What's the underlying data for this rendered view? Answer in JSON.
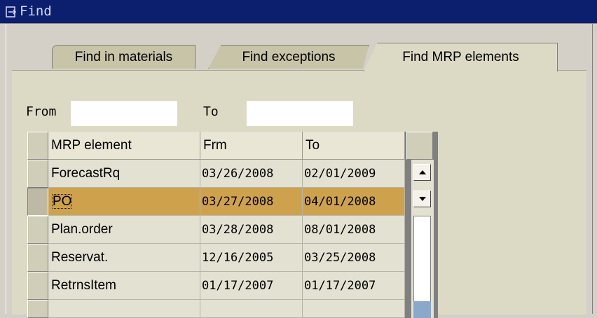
{
  "window": {
    "title": "Find"
  },
  "tabs": [
    {
      "label": "Find in materials",
      "active": false
    },
    {
      "label": "Find exceptions",
      "active": false
    },
    {
      "label": "Find MRP elements",
      "active": true
    }
  ],
  "fields": {
    "from_label": "From",
    "from_value": "",
    "to_label": "To",
    "to_value": ""
  },
  "table": {
    "columns": [
      "MRP element",
      "Frm",
      "To"
    ],
    "rows": [
      {
        "element": "ForecastRq",
        "from": "03/26/2008",
        "to": "02/01/2009",
        "selected": false
      },
      {
        "element": "PO",
        "from": "03/27/2008",
        "to": "04/01/2008",
        "selected": true
      },
      {
        "element": "Plan.order",
        "from": "03/28/2008",
        "to": "08/01/2008",
        "selected": false
      },
      {
        "element": "Reservat.",
        "from": "12/16/2005",
        "to": "03/25/2008",
        "selected": false
      },
      {
        "element": "RetrnsItem",
        "from": "01/17/2007",
        "to": "01/17/2007",
        "selected": false
      },
      {
        "element": "",
        "from": "",
        "to": "",
        "selected": false
      }
    ]
  },
  "colors": {
    "titlebar": "#0c1e6e",
    "selected_row": "#cea24c",
    "panel": "#dcdac4"
  }
}
